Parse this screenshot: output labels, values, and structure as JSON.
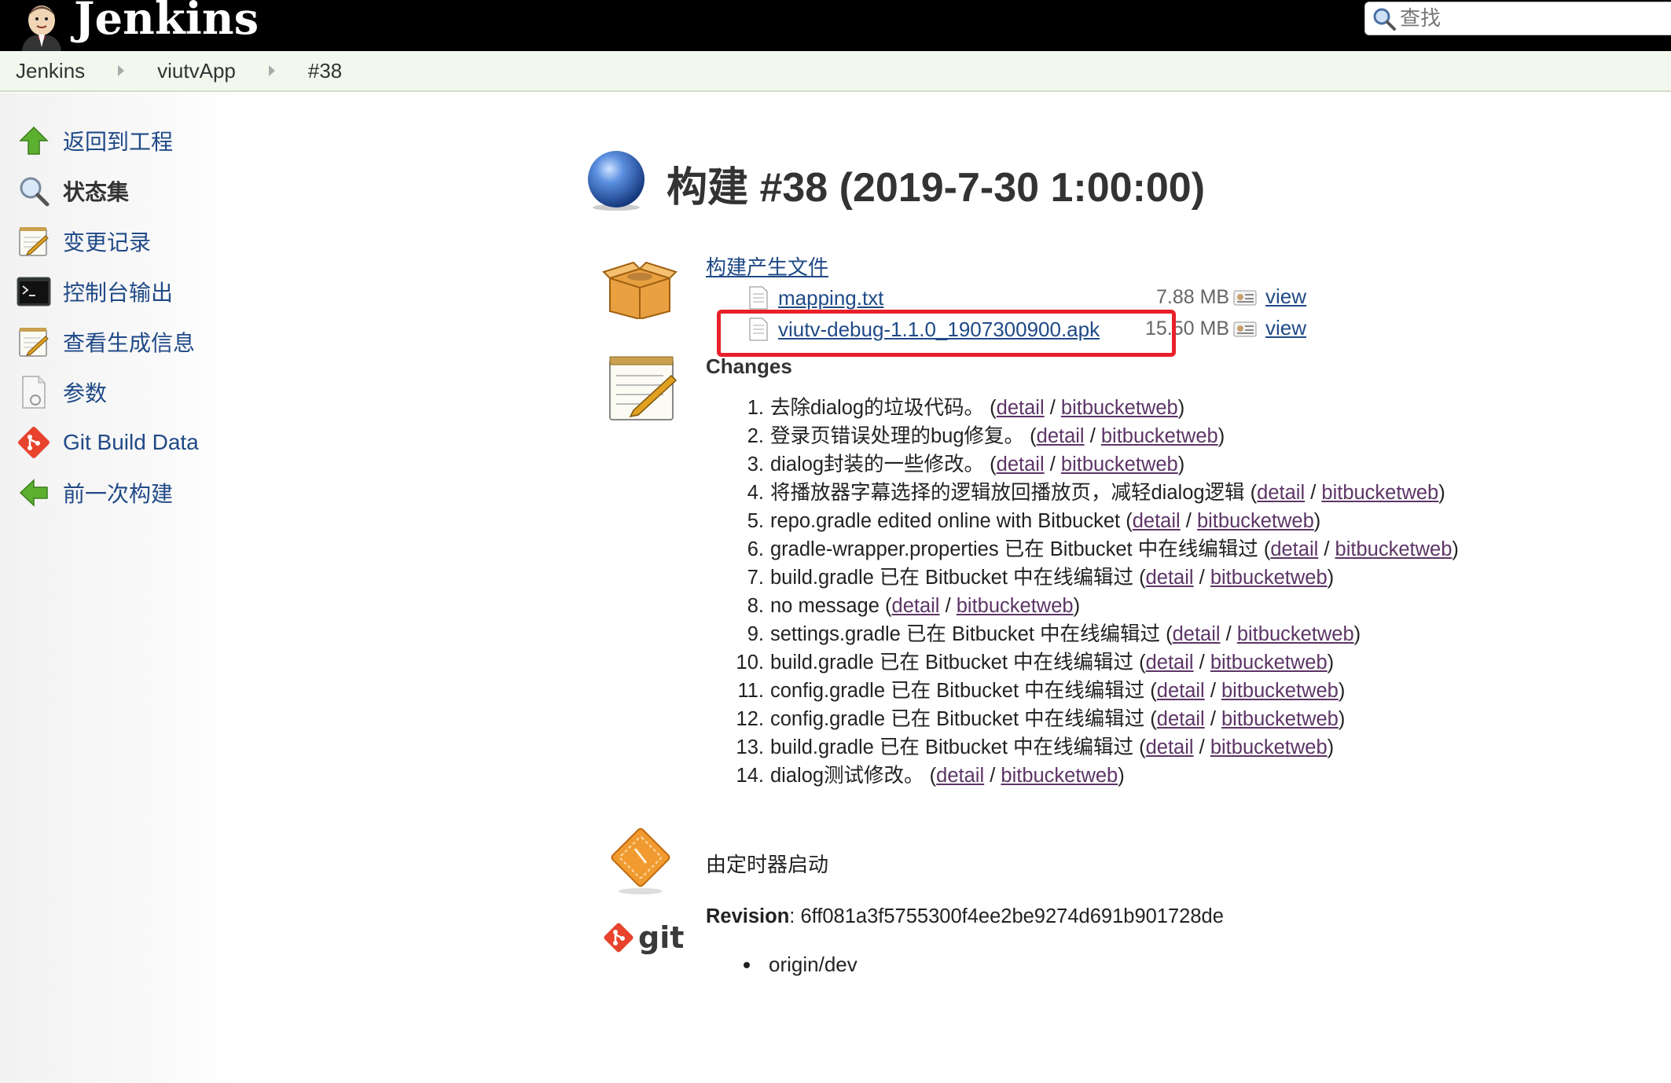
{
  "header": {
    "app_name": "Jenkins",
    "search_placeholder": "查找"
  },
  "breadcrumbs": [
    {
      "label": "Jenkins"
    },
    {
      "label": "viutvApp"
    },
    {
      "label": "#38"
    }
  ],
  "side_panel": {
    "tasks": [
      {
        "label": "返回到工程",
        "icon": "up-arrow-icon"
      },
      {
        "label": "状态集",
        "icon": "magnifier-icon",
        "active": true
      },
      {
        "label": "变更记录",
        "icon": "notepad-icon"
      },
      {
        "label": "控制台输出",
        "icon": "terminal-icon"
      },
      {
        "label": "查看生成信息",
        "icon": "notepad-icon"
      },
      {
        "label": "参数",
        "icon": "document-icon"
      },
      {
        "label": "Git Build Data",
        "icon": "git-diamond-icon"
      },
      {
        "label": "前一次构建",
        "icon": "left-arrow-icon"
      }
    ]
  },
  "main": {
    "title": "构建 #38 (2019-7-30 1:00:00)",
    "artifacts": {
      "heading": "构建产生文件",
      "files": [
        {
          "name": "mapping.txt",
          "size": "7.88 MB",
          "view_label": "view"
        },
        {
          "name": "viutv-debug-1.1.0_1907300900.apk",
          "size": "15.50 MB",
          "view_label": "view",
          "highlighted": true
        }
      ]
    },
    "changes": {
      "heading": "Changes",
      "detail_label": "detail",
      "web_label": "bitbucketweb",
      "items": [
        {
          "num": "1.",
          "text": "去除dialog的垃圾代码。"
        },
        {
          "num": "2.",
          "text": "登录页错误处理的bug修复。"
        },
        {
          "num": "3.",
          "text": "dialog封装的一些修改。"
        },
        {
          "num": "4.",
          "text": "将播放器字幕选择的逻辑放回播放页，减轻dialog逻辑"
        },
        {
          "num": "5.",
          "text": "repo.gradle edited online with Bitbucket"
        },
        {
          "num": "6.",
          "text": "gradle-wrapper.properties 已在 Bitbucket 中在线编辑过"
        },
        {
          "num": "7.",
          "text": "build.gradle 已在 Bitbucket 中在线编辑过"
        },
        {
          "num": "8.",
          "text": "no message"
        },
        {
          "num": "9.",
          "text": "settings.gradle 已在 Bitbucket 中在线编辑过"
        },
        {
          "num": "10.",
          "text": "build.gradle 已在 Bitbucket 中在线编辑过"
        },
        {
          "num": "11.",
          "text": "config.gradle 已在 Bitbucket 中在线编辑过"
        },
        {
          "num": "12.",
          "text": "config.gradle 已在 Bitbucket 中在线编辑过"
        },
        {
          "num": "13.",
          "text": "build.gradle 已在 Bitbucket 中在线编辑过"
        },
        {
          "num": "14.",
          "text": "dialog测试修改。"
        }
      ]
    },
    "cause": "由定时器启动",
    "git": {
      "logo_text": "git",
      "revision_label": "Revision",
      "revision": "6ff081a3f5755300f4ee2be9274d691b901728de",
      "branches": [
        "origin/dev"
      ]
    }
  },
  "colors": {
    "header_bg": "#000000",
    "breadcrumb_bg": "#f3f8ee",
    "link": "#204a87",
    "visited_link": "#5c3566",
    "highlight_box": "#e8202a",
    "build_ball": "#2a5db0"
  }
}
